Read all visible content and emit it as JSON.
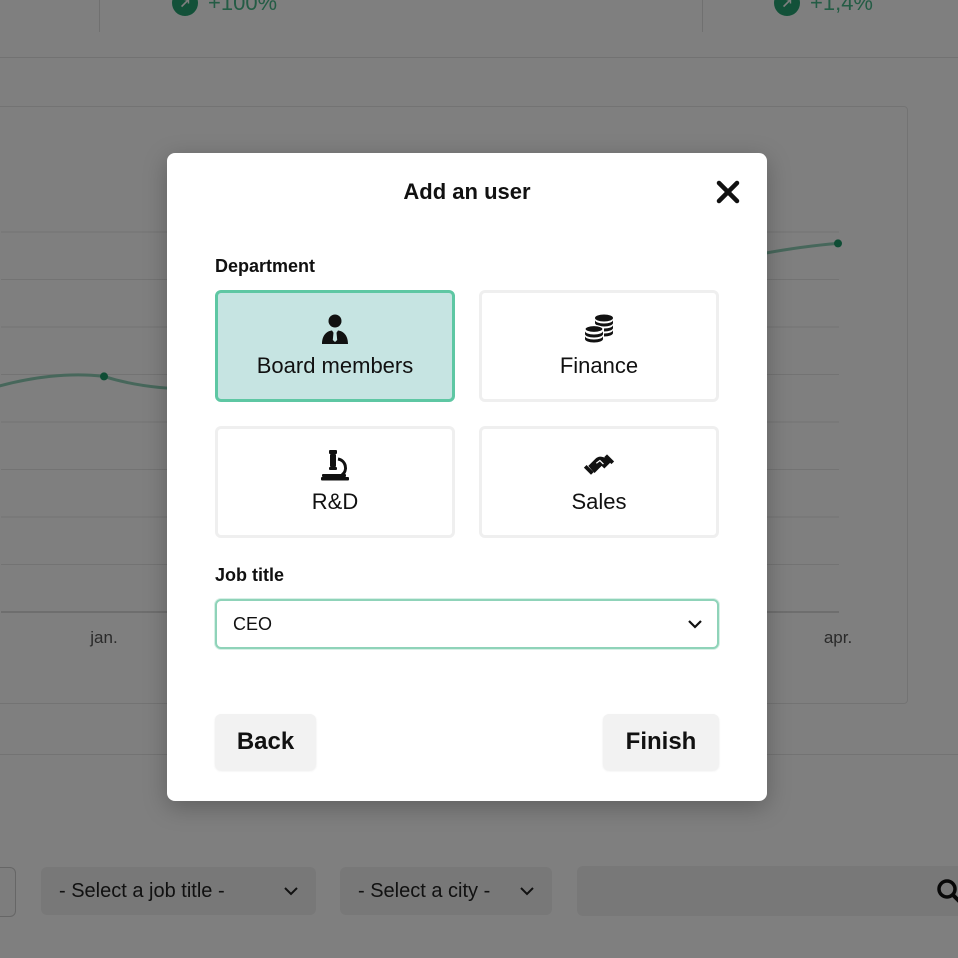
{
  "stats": [
    {
      "value": "+100%"
    },
    {
      "value": "+1,4%"
    }
  ],
  "chart_data": {
    "type": "line",
    "categories": [
      "jan.",
      "apr."
    ],
    "series": [
      {
        "values": [
          0.62,
          0.97
        ]
      }
    ]
  },
  "filters": {
    "job_title_placeholder": "- Select a job title -",
    "city_placeholder": "- Select a city -"
  },
  "modal": {
    "title": "Add an user",
    "department_label": "Department",
    "departments": [
      {
        "label": "Board members",
        "icon": "user-tie-icon",
        "selected": true
      },
      {
        "label": "Finance",
        "icon": "coins-icon",
        "selected": false
      },
      {
        "label": "R&D",
        "icon": "microscope-icon",
        "selected": false
      },
      {
        "label": "Sales",
        "icon": "handshake-icon",
        "selected": false
      }
    ],
    "job_title_label": "Job title",
    "job_title_value": "CEO",
    "back_label": "Back",
    "finish_label": "Finish"
  },
  "colors": {
    "accent": "#5ec7a3",
    "selected_bg": "#c6e4e2",
    "stat_green": "#49b98a"
  }
}
